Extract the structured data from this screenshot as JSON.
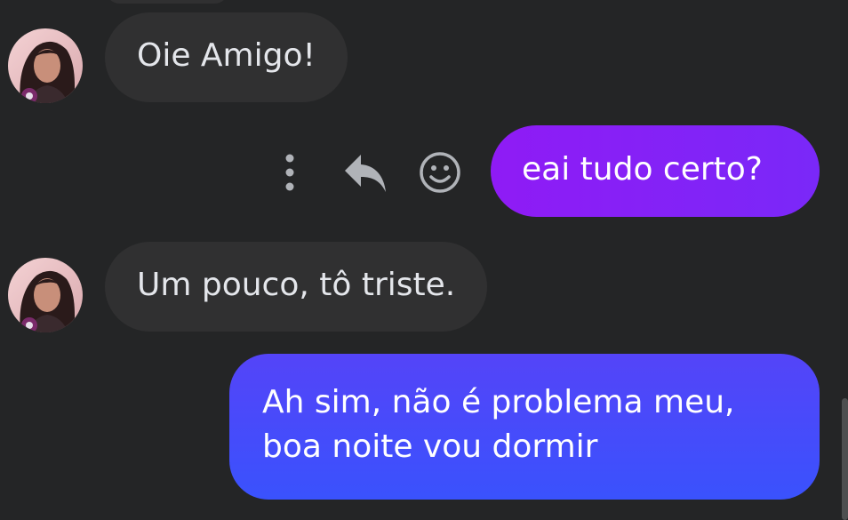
{
  "conversation": {
    "messages": [
      {
        "sender": "contact",
        "text": "Oie Amigo!"
      },
      {
        "sender": "me",
        "text": "eai tudo certo?"
      },
      {
        "sender": "contact",
        "text": "Um pouco, tô triste."
      },
      {
        "sender": "me",
        "text": "Ah sim, não é problema meu, boa noite vou dormir"
      }
    ],
    "hover_actions": [
      {
        "icon": "more-options-icon"
      },
      {
        "icon": "reply-icon"
      },
      {
        "icon": "react-emoji-icon"
      }
    ]
  },
  "colors": {
    "background": "#242526",
    "incoming_bubble": "#303031",
    "outgoing_bubble_purple": "#8f1bf5",
    "outgoing_bubble_blue": "#3a52fd",
    "text": "#e4e6eb",
    "icon": "#b0b3b8"
  }
}
